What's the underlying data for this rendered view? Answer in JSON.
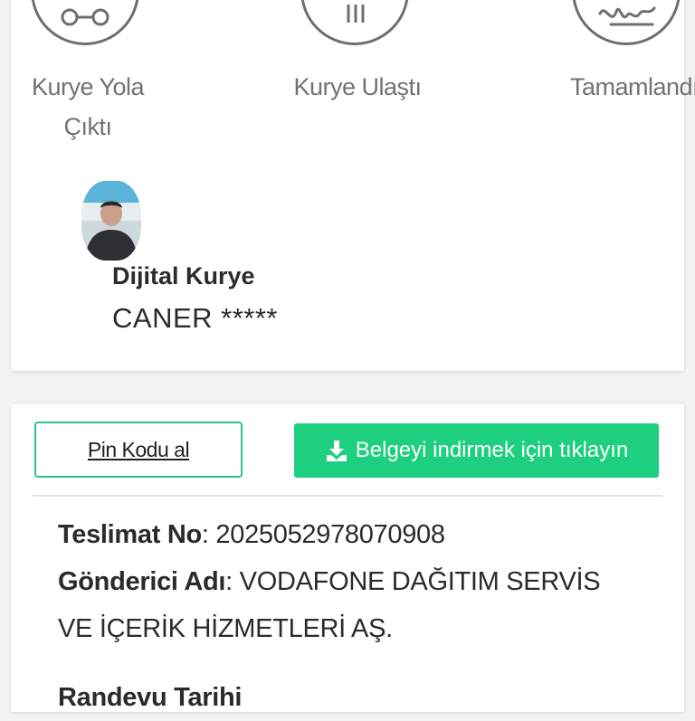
{
  "steps": [
    {
      "label_line1": "Kurye Yola",
      "label_line2": "Çıktı"
    },
    {
      "label_line1": "Kurye Ulaştı"
    },
    {
      "label_line1": "Tamamlandı"
    }
  ],
  "courier": {
    "role": "Dijital Kurye",
    "name": "CANER *****"
  },
  "actions": {
    "pin_label": "Pin Kodu al",
    "download_label": "Belgeyi indirmek için tıklayın"
  },
  "delivery": {
    "delivery_no_label": "Teslimat No",
    "delivery_no_value": ": 20250529780709​08",
    "sender_label": "Gönderici Adı",
    "sender_value_line1": ": VODAFONE DAĞITIM SERVİS",
    "sender_value_line2": "VE İÇERİK HİZMETLERİ AŞ.",
    "appointment_label": "Randevu Tarihi"
  },
  "colors": {
    "accent_green": "#1dcf7f",
    "pin_border": "#2ec18a",
    "icon_gray": "#6f6f6f"
  }
}
